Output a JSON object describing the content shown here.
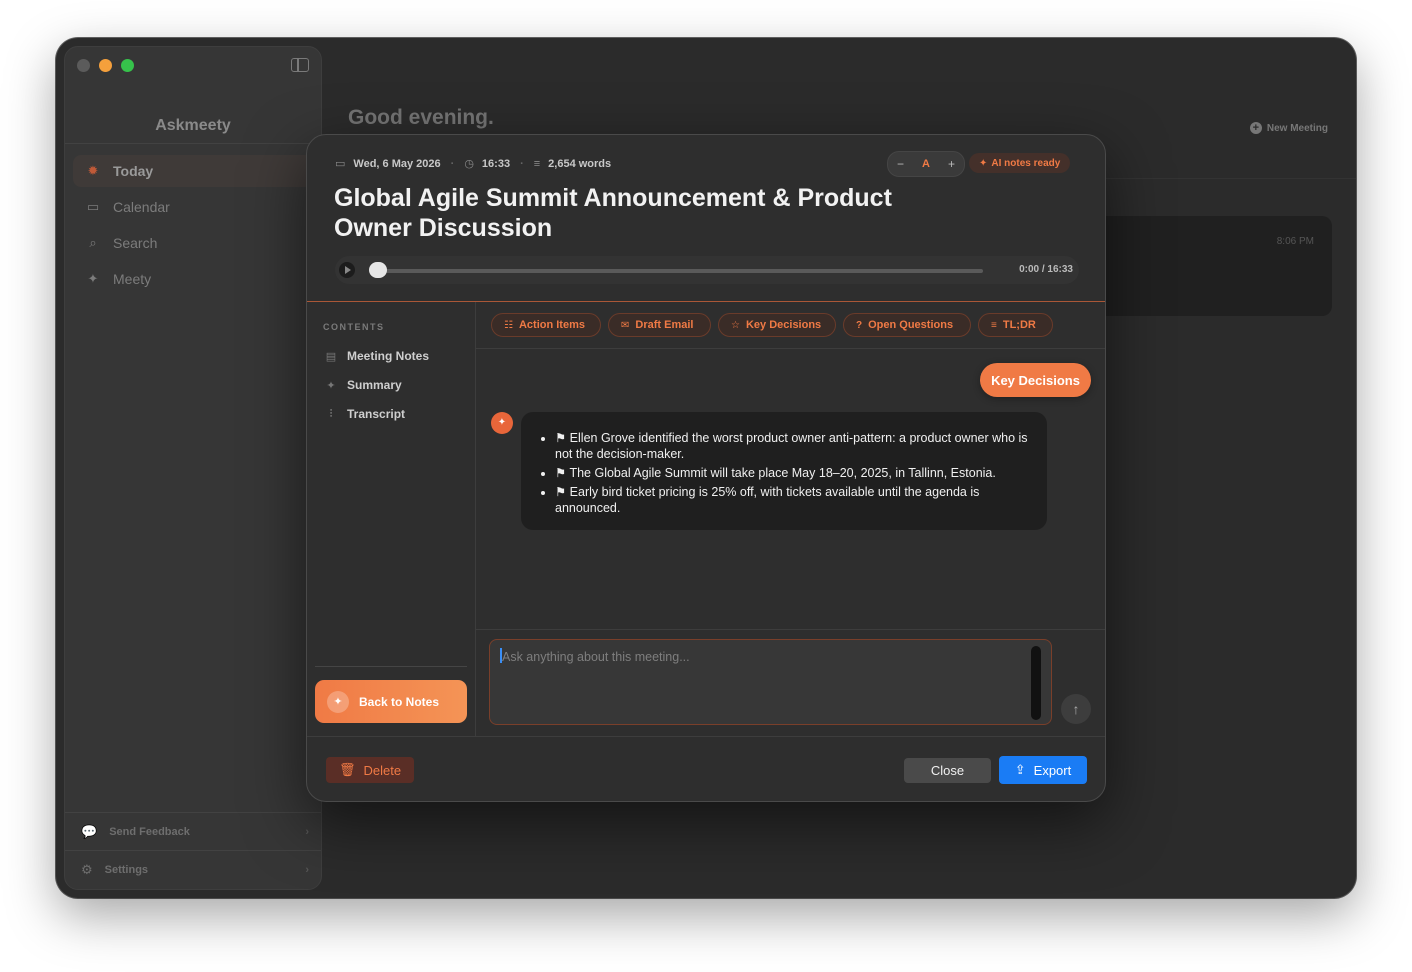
{
  "sidebar": {
    "app_name": "Askmeety",
    "items": [
      {
        "label": "Today",
        "icon": "sun-icon"
      },
      {
        "label": "Calendar",
        "icon": "calendar-icon"
      },
      {
        "label": "Search",
        "icon": "search-icon"
      },
      {
        "label": "Meety",
        "icon": "sparkle-icon"
      }
    ],
    "footer": {
      "feedback": "Send Feedback",
      "settings": "Settings"
    }
  },
  "main": {
    "greeting": "Good evening.",
    "new_meeting": "New Meeting",
    "card_time": "8:06 PM"
  },
  "modal": {
    "date": "Wed, 6 May 2026",
    "duration": "16:33",
    "words": "2,654 words",
    "font_minus": "−",
    "font_label": "A",
    "font_plus": "+",
    "ai_status": "AI notes ready",
    "title": "Global Agile Summit Announcement & Product Owner Discussion",
    "player": {
      "time": "0:00 / 16:33",
      "progress": 0.0
    },
    "contents_title": "CONTENTS",
    "toc": [
      "Meeting Notes",
      "Summary",
      "Transcript"
    ],
    "back_to_notes": "Back to Notes",
    "chips": [
      "Action Items",
      "Draft Email",
      "Key Decisions",
      "Open Questions",
      "TL;DR"
    ],
    "chat": {
      "user_message": "Key Decisions",
      "ai_bullets": [
        "⚑ Ellen Grove identified the worst product owner anti-pattern: a product owner who is not the decision-maker.",
        "⚑ The Global Agile Summit will take place May 18–20, 2025, in Tallinn, Estonia.",
        "⚑ Early bird ticket pricing is 25% off, with tickets available until the agenda is announced."
      ]
    },
    "input_placeholder": "Ask anything about this meeting...",
    "buttons": {
      "delete": "Delete",
      "close": "Close",
      "export": "Export"
    }
  },
  "colors": {
    "accent": "#f07a45",
    "primary_blue": "#1a7cf5",
    "background": "#2b2b2b"
  }
}
